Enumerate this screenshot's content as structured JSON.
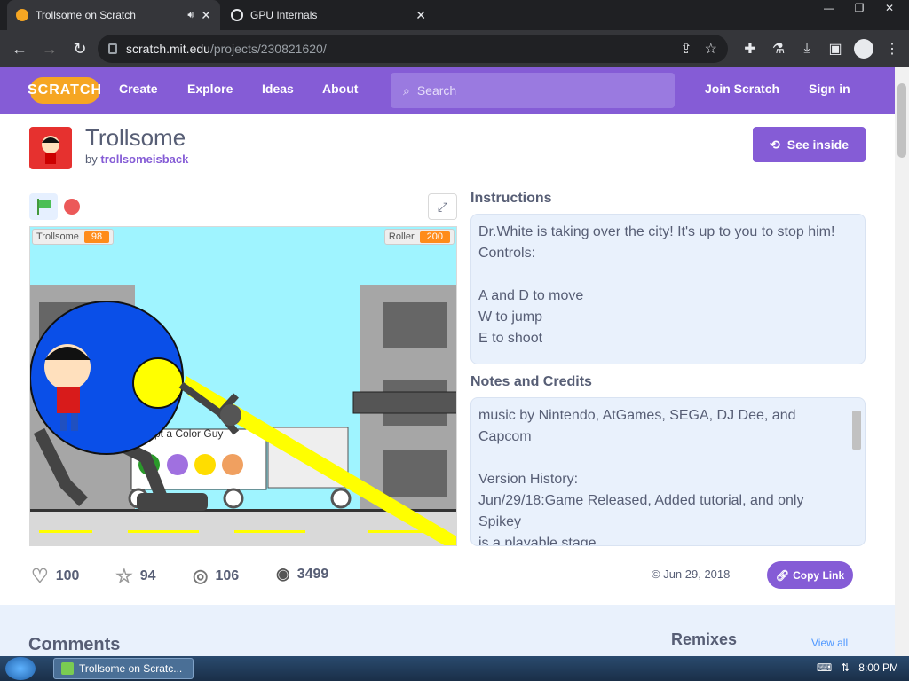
{
  "browser": {
    "tabs": [
      {
        "title": "Trollsome on Scratch",
        "active": true
      },
      {
        "title": "GPU Internals",
        "active": false
      }
    ],
    "url_host": "scratch.mit.edu",
    "url_path": "/projects/230821620/"
  },
  "nav": {
    "logo": "SCRATCH",
    "links": [
      "Create",
      "Explore",
      "Ideas",
      "About"
    ],
    "search_placeholder": "Search",
    "join": "Join Scratch",
    "signin": "Sign in"
  },
  "project": {
    "title": "Trollsome",
    "by_prefix": "by",
    "author": "trollsomeisback",
    "see_inside": "See inside",
    "stage_monitors": [
      {
        "label": "Trollsome",
        "value": "98"
      },
      {
        "label": "Roller",
        "value": "200"
      }
    ],
    "stage_sign": "pt a Color Guy"
  },
  "instructions": {
    "title": "Instructions",
    "lines": [
      "Dr.White is taking over the city! It's up to you to stop him!",
      "Controls:",
      "",
      "A and D to move",
      "W to jump",
      "E to shoot"
    ]
  },
  "notes": {
    "title": "Notes and Credits",
    "lines": [
      "music by Nintendo, AtGames, SEGA, DJ Dee, and",
      "Capcom",
      "",
      "Version History:",
      "Jun/29/18:Game Released, Added tutorial, and only Spikey",
      "is a playable stage."
    ]
  },
  "stats": {
    "loves": "100",
    "favorites": "94",
    "remixes": "106",
    "views": "3499",
    "date": "© Jun 29, 2018",
    "copy_link": "Copy Link"
  },
  "lower": {
    "comments": "Comments",
    "remixes": "Remixes",
    "view_all": "View all"
  },
  "taskbar": {
    "item": "Trollsome on Scratc...",
    "time": "8:00 PM"
  }
}
